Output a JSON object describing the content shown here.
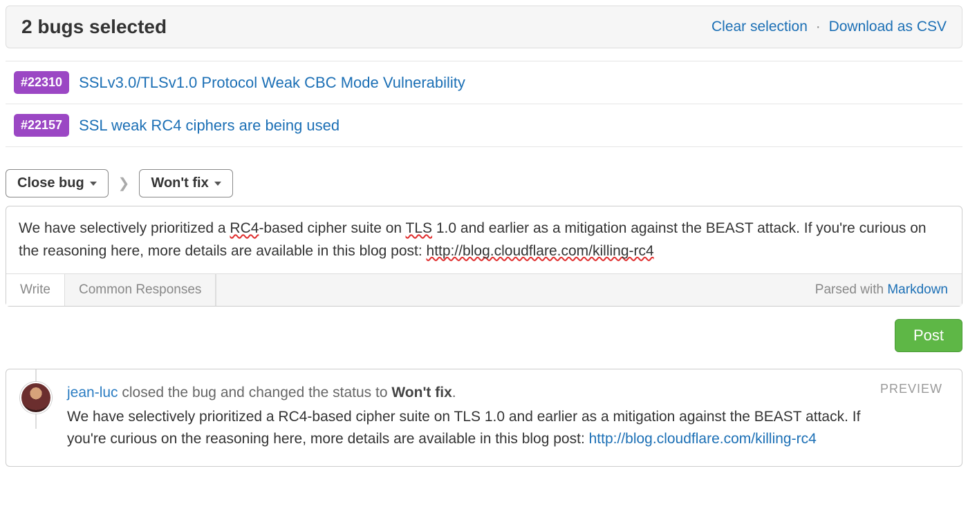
{
  "selection": {
    "title": "2 bugs selected",
    "clear": "Clear selection",
    "download": "Download as CSV"
  },
  "bugs": [
    {
      "id": "#22310",
      "title": "SSLv3.0/TLSv1.0 Protocol Weak CBC Mode Vulnerability"
    },
    {
      "id": "#22157",
      "title": "SSL weak RC4 ciphers are being used"
    }
  ],
  "actions": {
    "close_bug": "Close bug",
    "wont_fix": "Won't fix"
  },
  "editor": {
    "text_pre": "We have selectively prioritized a ",
    "rc4": "RC4",
    "text_mid1": "-based cipher suite on ",
    "tls": "TLS",
    "text_mid2": " 1.0 and earlier as a mitigation against the BEAST attack. If you're curious on the reasoning here, more details are available in this blog post: ",
    "url": "http://blog.cloudflare.com/killing-rc4",
    "tab_write": "Write",
    "tab_common": "Common Responses",
    "parsed_label": "Parsed with ",
    "parsed_link": "Markdown"
  },
  "post_button": "Post",
  "preview": {
    "label": "PREVIEW",
    "user": "jean-luc",
    "action_text": " closed the bug and changed the status to ",
    "status": "Won't fix",
    "period": ".",
    "message": "We have selectively prioritized a RC4-based cipher suite on TLS 1.0 and earlier as a mitigation against the BEAST attack. If you're curious on the reasoning here, more details are available in this blog post: ",
    "link": "http://blog.cloudflare.com/killing-rc4"
  }
}
